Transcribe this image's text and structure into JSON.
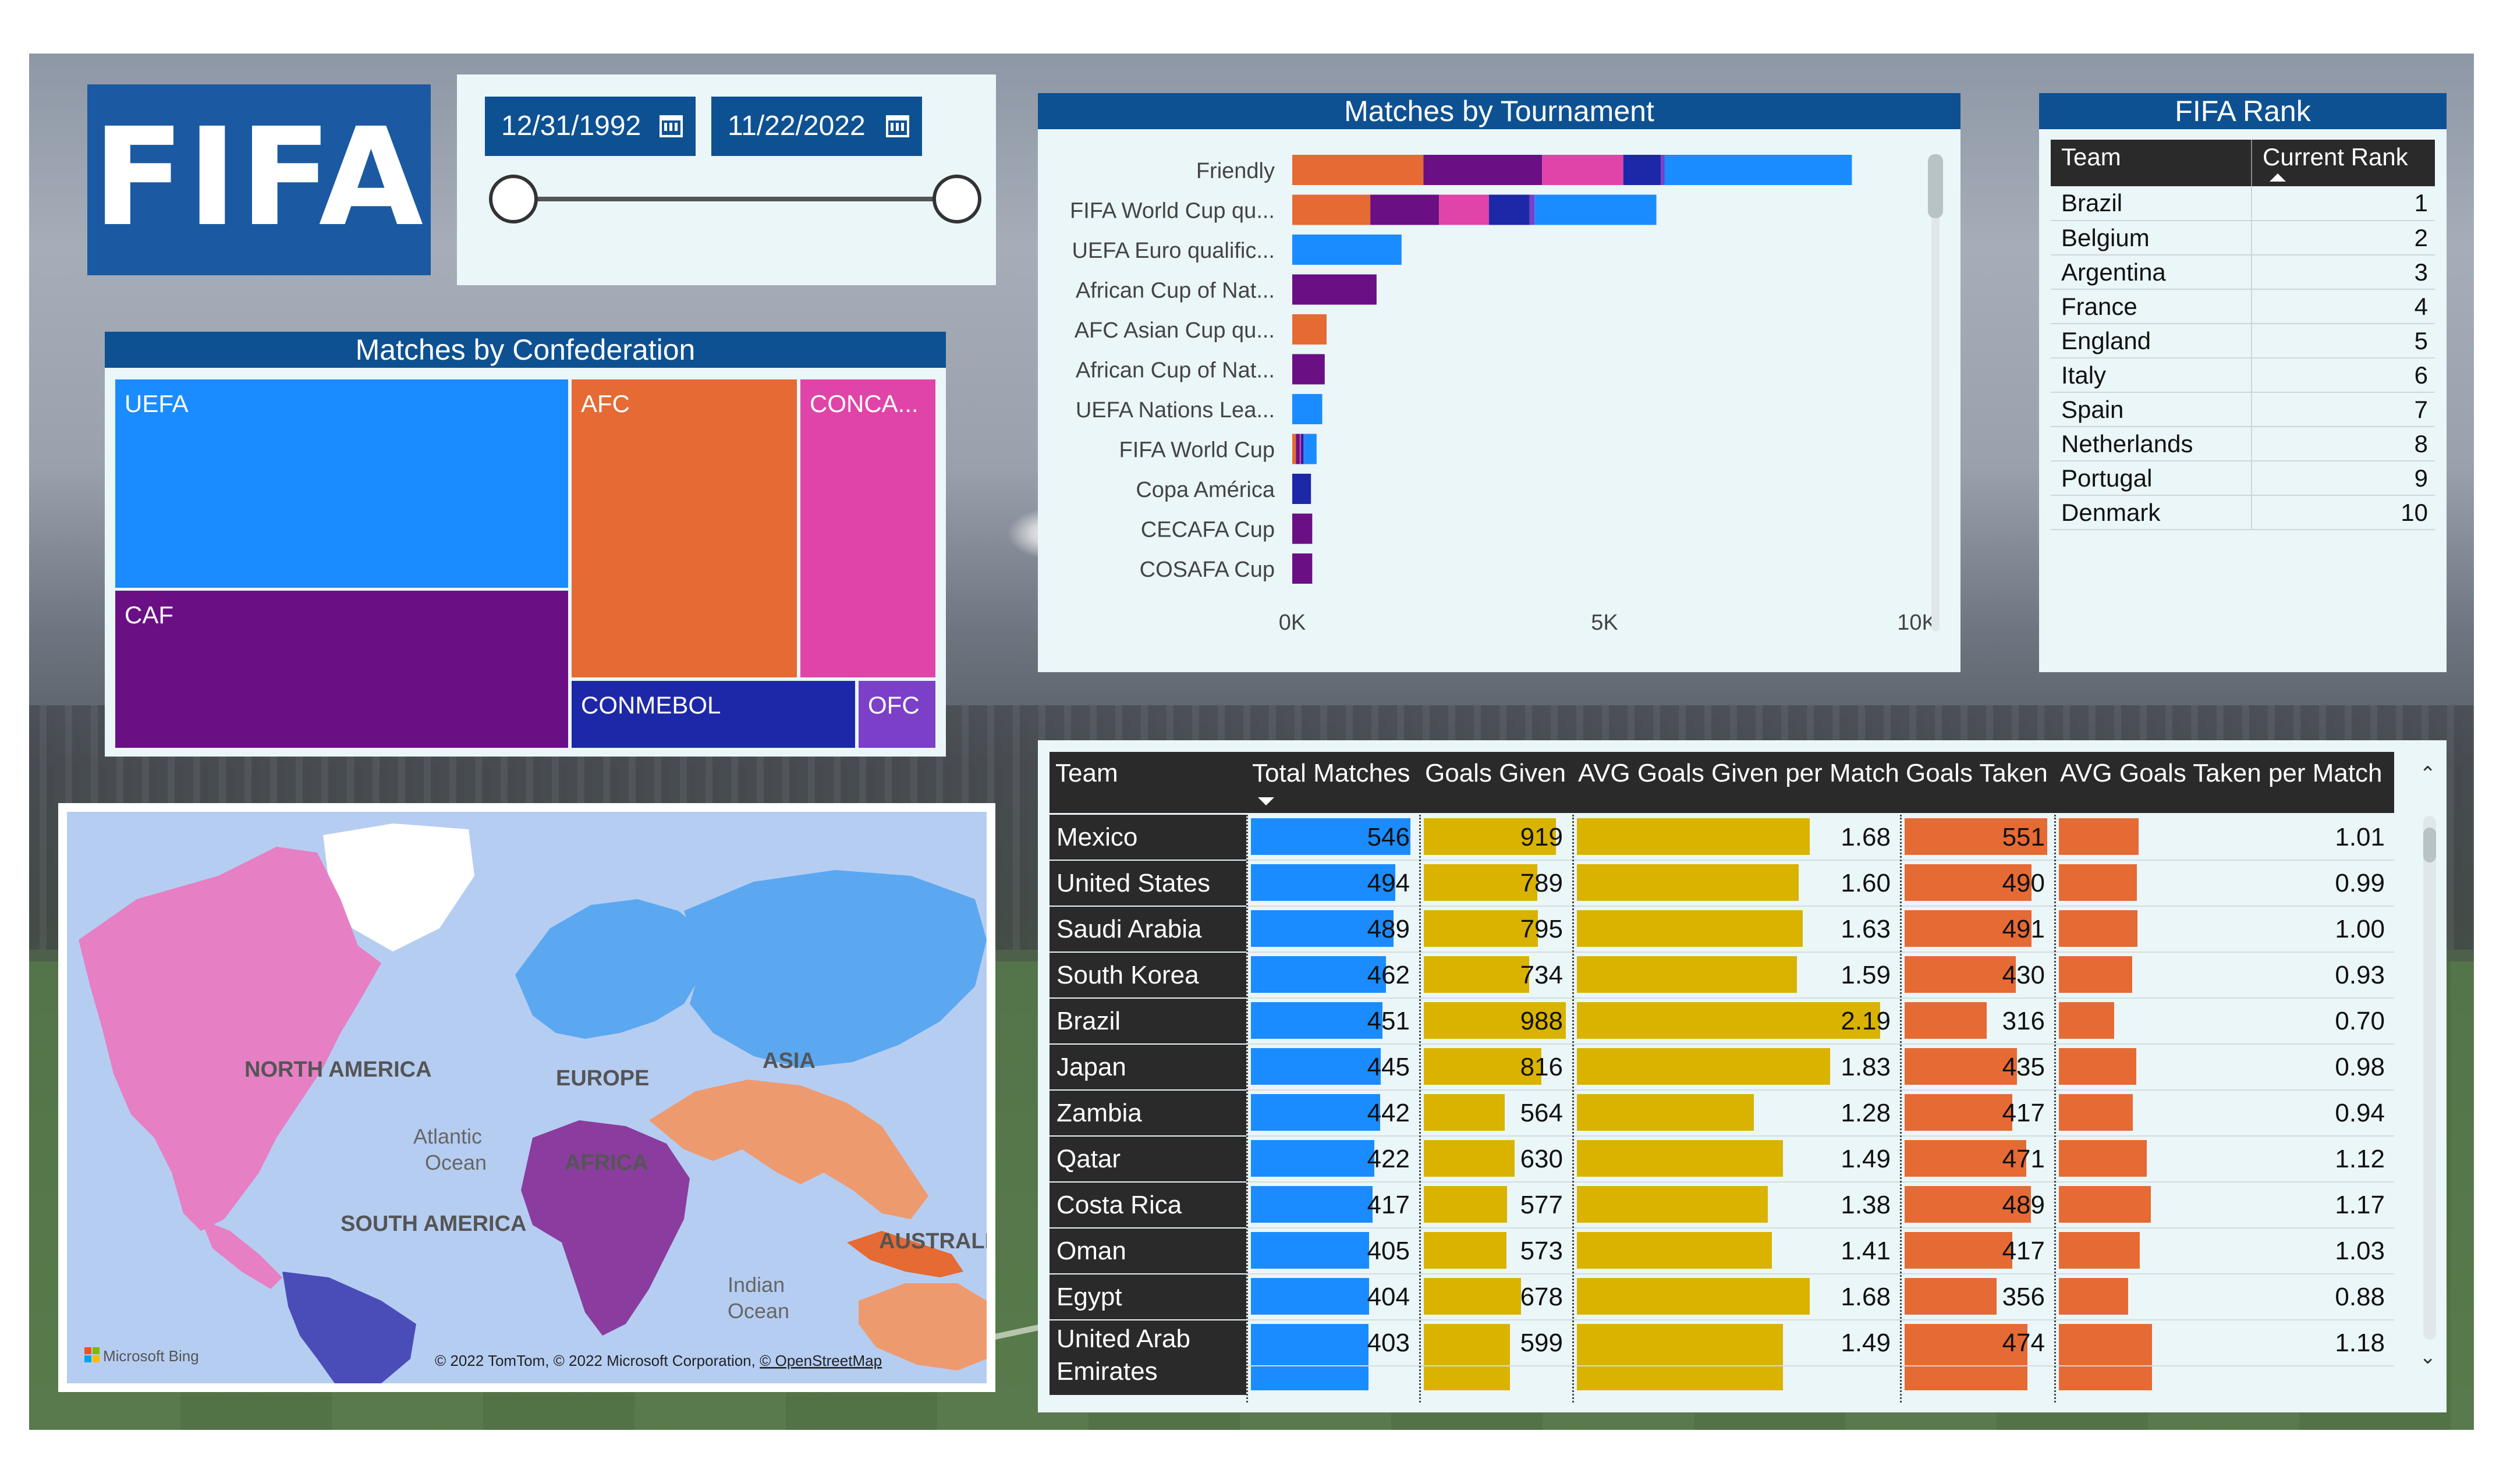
{
  "logo": {
    "text": "FIFA"
  },
  "date_slicer": {
    "start": "12/31/1992",
    "end": "11/22/2022"
  },
  "treemap": {
    "title": "Matches by Confederation",
    "tiles": [
      {
        "label": "UEFA",
        "color": "#1a8cff"
      },
      {
        "label": "CAF",
        "color": "#6b0f85"
      },
      {
        "label": "AFC",
        "color": "#e56a34"
      },
      {
        "label": "CONCA...",
        "color": "#e044a8"
      },
      {
        "label": "CONMEBOL",
        "color": "#1d28a8"
      },
      {
        "label": "OFC",
        "color": "#7b3fc8"
      }
    ]
  },
  "chart_data": {
    "type": "bar",
    "title": "Matches by Tournament",
    "orientation": "horizontal",
    "stacked": true,
    "xlim": [
      0,
      10000
    ],
    "x_ticks": [
      "0K",
      "5K",
      "10K"
    ],
    "categories": [
      "Friendly",
      "FIFA World Cup qu...",
      "UEFA Euro qualific...",
      "African Cup of Nat...",
      "AFC Asian Cup qu...",
      "African Cup of Nat...",
      "UEFA Nations Lea...",
      "FIFA World Cup",
      "Copa América",
      "CECAFA Cup",
      "COSAFA Cup"
    ],
    "series": [
      {
        "color": "#e56a34",
        "values": [
          2100,
          1250,
          0,
          0,
          550,
          0,
          0,
          60,
          0,
          0,
          0
        ]
      },
      {
        "color": "#6b0f85",
        "values": [
          1900,
          1100,
          0,
          1350,
          0,
          520,
          0,
          60,
          0,
          320,
          320
        ]
      },
      {
        "color": "#e044a8",
        "values": [
          1300,
          800,
          0,
          0,
          0,
          0,
          0,
          20,
          0,
          0,
          0
        ]
      },
      {
        "color": "#1d28a8",
        "values": [
          600,
          650,
          0,
          0,
          0,
          0,
          0,
          40,
          300,
          0,
          0
        ]
      },
      {
        "color": "#7b3fc8",
        "values": [
          60,
          80,
          0,
          0,
          0,
          0,
          0,
          10,
          0,
          0,
          0
        ]
      },
      {
        "color": "#1a8cff",
        "values": [
          3000,
          1950,
          1750,
          0,
          0,
          0,
          480,
          200,
          0,
          0,
          0
        ]
      }
    ]
  },
  "rank": {
    "title": "FIFA Rank",
    "headers": [
      "Team",
      "Current Rank"
    ],
    "rows": [
      [
        "Brazil",
        "1"
      ],
      [
        "Belgium",
        "2"
      ],
      [
        "Argentina",
        "3"
      ],
      [
        "France",
        "4"
      ],
      [
        "England",
        "5"
      ],
      [
        "Italy",
        "6"
      ],
      [
        "Spain",
        "7"
      ],
      [
        "Netherlands",
        "8"
      ],
      [
        "Portugal",
        "9"
      ],
      [
        "Denmark",
        "10"
      ]
    ]
  },
  "map": {
    "labels": {
      "north_america": "NORTH AMERICA",
      "europe": "EUROPE",
      "asia": "ASIA",
      "africa": "AFRICA",
      "south_america": "SOUTH AMERICA",
      "australia": "AUSTRALI",
      "atlantic1": "Atlantic",
      "atlantic2": "Ocean",
      "indian1": "Indian",
      "indian2": "Ocean"
    },
    "bing": "Microsoft Bing",
    "attribution": "© 2022 TomTom, © 2022 Microsoft Corporation, ",
    "attribution_link": "© OpenStreetMap",
    "colors": {
      "north_america": "#e67fc4",
      "europe": "#5ba8f0",
      "asia": "#5ba8f0",
      "africa": "#8a3d9e",
      "south_america": "#4a4db8",
      "australia": "#ee9a6f",
      "se_asia": "#e56a34",
      "ocean": "#b6cdf2",
      "other_land": "#e8e8e8"
    }
  },
  "stats": {
    "headers": [
      "Team",
      "Total Matches",
      "Goals Given",
      "AVG Goals Given per Match",
      "Goals Taken",
      "AVG Goals Taken per Match"
    ],
    "colors": {
      "total": "#1a8cff",
      "given": "#d9b300",
      "avg_given": "#d9b300",
      "taken": "#e56a34",
      "avg_taken": "#e56a34"
    },
    "rows": [
      {
        "team": "Mexico",
        "total": 546,
        "given": 919,
        "avg_given": "1.68",
        "taken": 551,
        "avg_taken": "1.01"
      },
      {
        "team": "United States",
        "total": 494,
        "given": 789,
        "avg_given": "1.60",
        "taken": 490,
        "avg_taken": "0.99"
      },
      {
        "team": "Saudi Arabia",
        "total": 489,
        "given": 795,
        "avg_given": "1.63",
        "taken": 491,
        "avg_taken": "1.00"
      },
      {
        "team": "South Korea",
        "total": 462,
        "given": 734,
        "avg_given": "1.59",
        "taken": 430,
        "avg_taken": "0.93"
      },
      {
        "team": "Brazil",
        "total": 451,
        "given": 988,
        "avg_given": "2.19",
        "taken": 316,
        "avg_taken": "0.70"
      },
      {
        "team": "Japan",
        "total": 445,
        "given": 816,
        "avg_given": "1.83",
        "taken": 435,
        "avg_taken": "0.98"
      },
      {
        "team": "Zambia",
        "total": 442,
        "given": 564,
        "avg_given": "1.28",
        "taken": 417,
        "avg_taken": "0.94"
      },
      {
        "team": "Qatar",
        "total": 422,
        "given": 630,
        "avg_given": "1.49",
        "taken": 471,
        "avg_taken": "1.12"
      },
      {
        "team": "Costa Rica",
        "total": 417,
        "given": 577,
        "avg_given": "1.38",
        "taken": 489,
        "avg_taken": "1.17"
      },
      {
        "team": "Oman",
        "total": 405,
        "given": 573,
        "avg_given": "1.41",
        "taken": 417,
        "avg_taken": "1.03"
      },
      {
        "team": "Egypt",
        "total": 404,
        "given": 678,
        "avg_given": "1.68",
        "taken": 356,
        "avg_taken": "0.88"
      },
      {
        "team": "United Arab Emirates",
        "total": 403,
        "given": 599,
        "avg_given": "1.49",
        "taken": 474,
        "avg_taken": "1.18"
      }
    ]
  }
}
